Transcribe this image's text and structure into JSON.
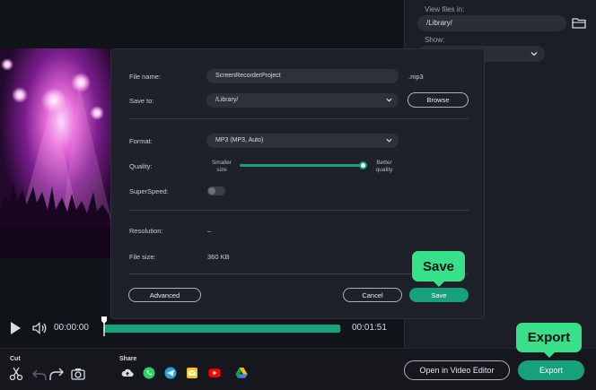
{
  "right_panel": {
    "view_files_label": "View files in:",
    "view_files_value": "/Library/",
    "show_label": "Show:"
  },
  "dialog": {
    "file_name_label": "File name:",
    "file_name_value": "ScreenRecorderProject",
    "file_extension": ".mp3",
    "save_to_label": "Save to:",
    "save_to_value": "/Library/",
    "browse_label": "Browse",
    "format_label": "Format:",
    "format_value": "MP3 (MP3, Auto)",
    "quality_label": "Quality:",
    "quality_min_line1": "Smaller",
    "quality_min_line2": "size",
    "quality_max_line1": "Better",
    "quality_max_line2": "quality",
    "quality_level": 1.0,
    "superspeed_label": "SuperSpeed:",
    "superspeed_on": false,
    "resolution_label": "Resolution:",
    "resolution_value": "–",
    "file_size_label": "File size:",
    "file_size_value": "360 KB",
    "advanced_label": "Advanced",
    "cancel_label": "Cancel",
    "save_label": "Save"
  },
  "playback": {
    "current_time": "00:00:00",
    "total_time": "00:01:51"
  },
  "toolbar": {
    "cut_label": "Cut",
    "share_label": "Share",
    "open_editor_label": "Open in Video Editor",
    "export_label": "Export"
  },
  "callouts": {
    "save": "Save",
    "export": "Export"
  },
  "colors": {
    "accent_green": "#16a07c",
    "callout_green": "#38e08a",
    "dialog_bg": "#1e2129",
    "field_bg": "#2d313b"
  }
}
